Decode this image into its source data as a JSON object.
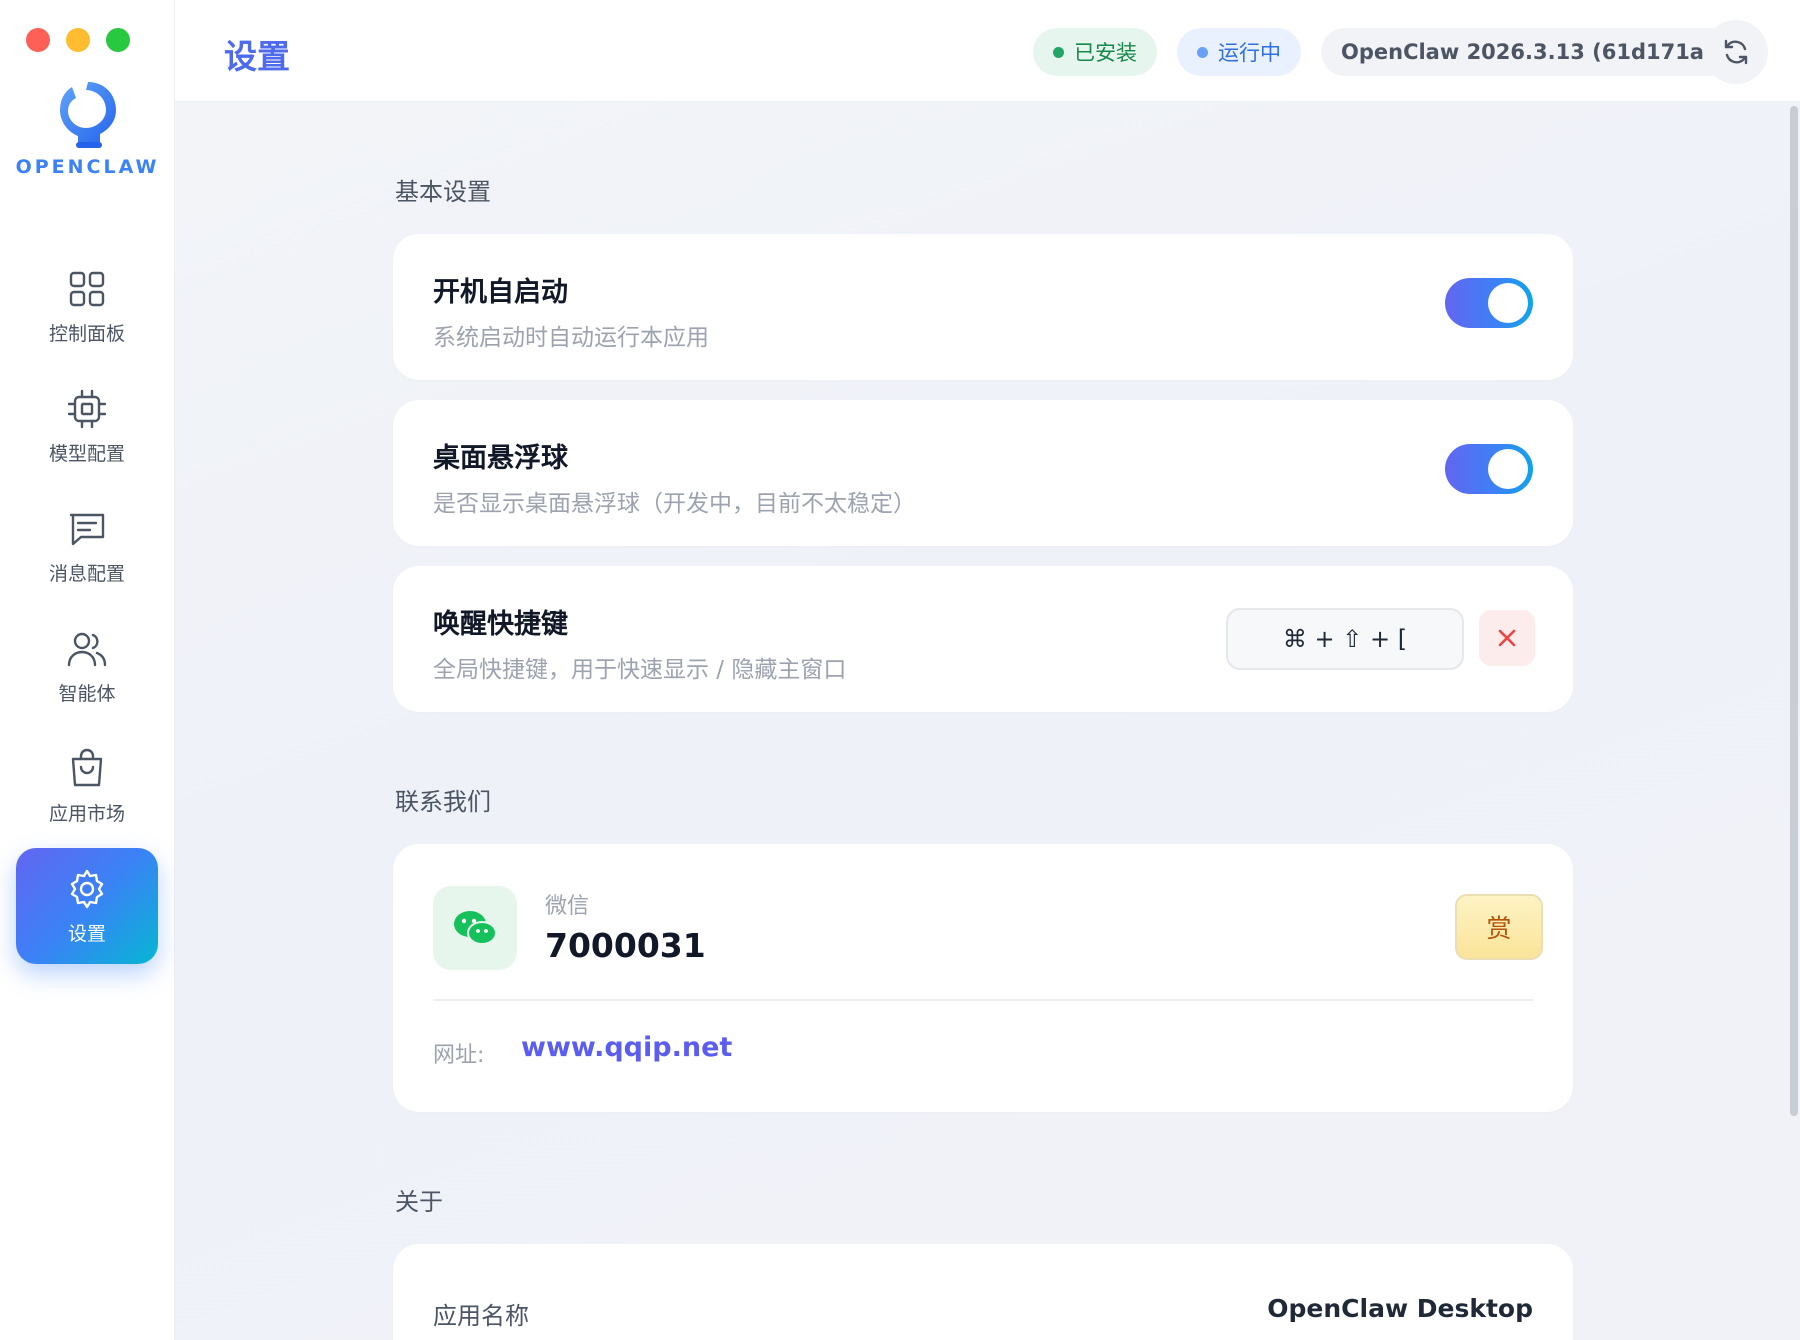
{
  "window": {
    "traffic_lights": {
      "close": "#fe5f57",
      "minimize": "#febc2e",
      "zoom": "#28c840"
    }
  },
  "brand": {
    "logo_text": "OPENCLAW",
    "accent_color": "#3b82f6"
  },
  "sidebar": {
    "items": [
      {
        "label": "控制面板",
        "icon": "grid-icon",
        "active": false
      },
      {
        "label": "模型配置",
        "icon": "cpu-chip-icon",
        "active": false
      },
      {
        "label": "消息配置",
        "icon": "message-icon",
        "active": false
      },
      {
        "label": "智能体",
        "icon": "users-icon",
        "active": false
      },
      {
        "label": "应用市场",
        "icon": "shopping-bag-icon",
        "active": false
      },
      {
        "label": "设置",
        "icon": "gear-icon",
        "active": true
      }
    ]
  },
  "header": {
    "title": "设置",
    "status_installed": "已安装",
    "status_running": "运行中",
    "version": "OpenClaw 2026.3.13 (61d171a)",
    "refresh_icon": "refresh-icon"
  },
  "basic": {
    "section_title": "基本设置",
    "autostart": {
      "title": "开机自启动",
      "desc": "系统启动时自动运行本应用",
      "enabled": true
    },
    "floating_ball": {
      "title": "桌面悬浮球",
      "desc": "是否显示桌面悬浮球（开发中，目前不太稳定）",
      "enabled": true
    },
    "hotkey": {
      "title": "唤醒快捷键",
      "desc": "全局快捷键，用于快速显示 / 隐藏主窗口",
      "value": "⌘ + ⇧ + ["
    }
  },
  "contact": {
    "section_title": "联系我们",
    "wechat_label": "微信",
    "wechat_id": "7000031",
    "reward_label": "赏",
    "site_label": "网址:",
    "site_url": "www.qqip.net"
  },
  "about": {
    "section_title": "关于",
    "app_name_label": "应用名称",
    "app_name_value": "OpenClaw Desktop"
  }
}
